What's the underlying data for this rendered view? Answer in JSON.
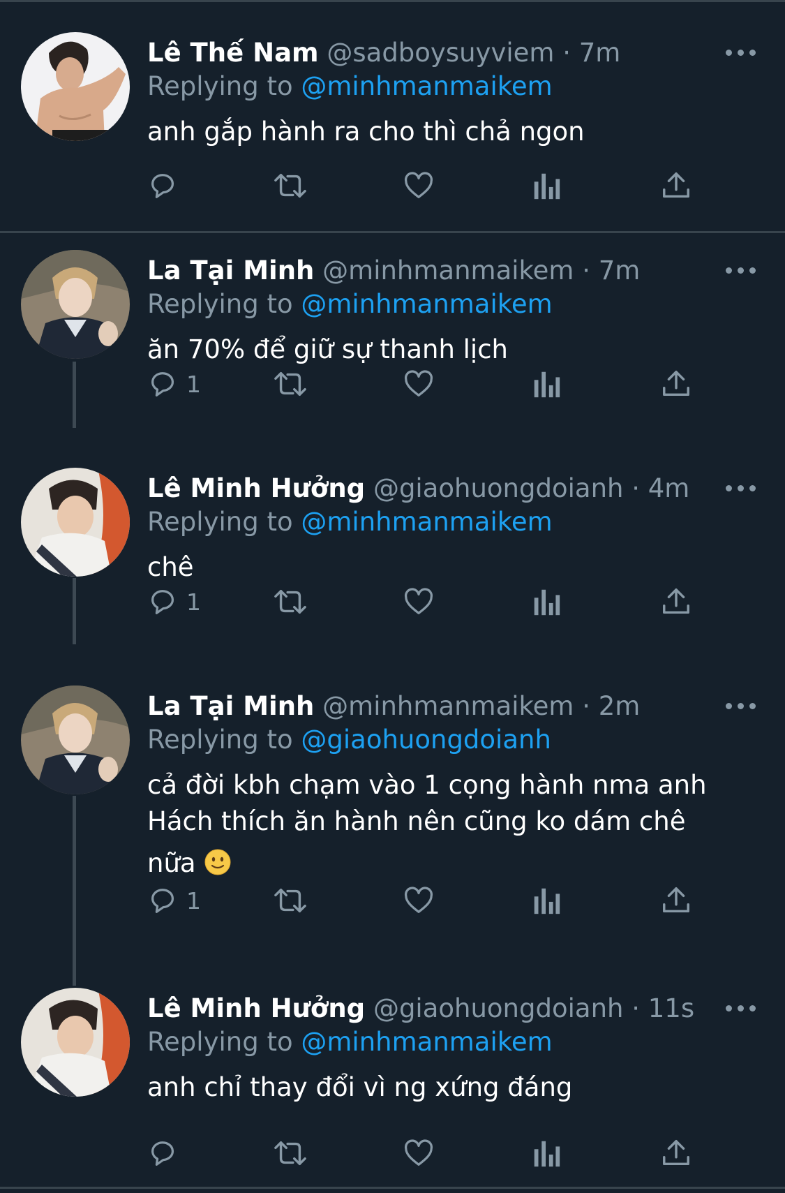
{
  "tweets": [
    {
      "name": "Lê Thế Nam",
      "handle": "@sadboysuyviem",
      "dot": "·",
      "time": "7m",
      "replying_to_prefix": "Replying to",
      "replying_to": "@minhmanmaikem",
      "text": "anh gắp hành ra cho thì chả ngon",
      "reply_count": ""
    },
    {
      "name": "La Tại Minh",
      "handle": "@minhmanmaikem",
      "dot": "·",
      "time": "7m",
      "replying_to_prefix": "Replying to",
      "replying_to": "@minhmanmaikem",
      "text": "ăn 70% để giữ sự thanh lịch",
      "reply_count": "1"
    },
    {
      "name": "Lê Minh Hưởng",
      "handle": "@giaohuongdoianh",
      "dot": "·",
      "time": "4m",
      "replying_to_prefix": "Replying to",
      "replying_to": "@minhmanmaikem",
      "text": "chê",
      "reply_count": "1"
    },
    {
      "name": "La Tại Minh",
      "handle": "@minhmanmaikem",
      "dot": "·",
      "time": "2m",
      "replying_to_prefix": "Replying to",
      "replying_to": "@giaohuongdoianh",
      "text_line1": "cả đời kbh chạm vào 1 cọng hành nma anh",
      "text_line2": "Hách thích ăn hành nên cũng ko dám chê",
      "text_line3": "nữa",
      "emoji": "slightly-smiling-face",
      "reply_count": "1"
    },
    {
      "name": "Lê Minh Hưởng",
      "handle": "@giaohuongdoianh",
      "dot": "·",
      "time": "11s",
      "replying_to_prefix": "Replying to",
      "replying_to": "@minhmanmaikem",
      "text": "anh chỉ thay đổi vì ng xứng đáng",
      "reply_count": ""
    }
  ],
  "icons": {
    "reply": "reply-icon",
    "retweet": "retweet-icon",
    "like": "heart-icon",
    "analytics": "analytics-icon",
    "share": "share-icon",
    "more": "more-icon"
  },
  "colors": {
    "background": "#15202b",
    "text": "#ffffff",
    "secondary": "#8899a6",
    "link": "#1da1f2",
    "divider": "#38444d"
  }
}
